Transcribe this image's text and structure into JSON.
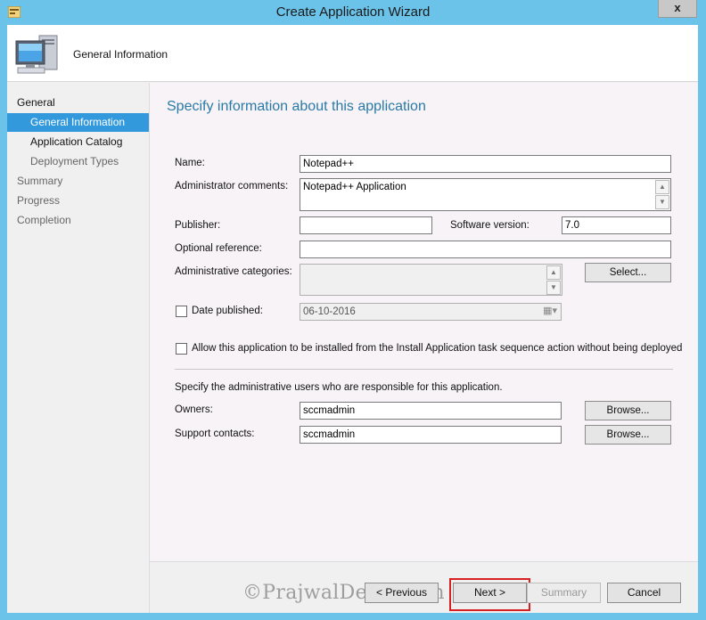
{
  "window": {
    "title": "Create Application Wizard",
    "close_glyph": "x"
  },
  "header": {
    "title": "General Information",
    "icon": "computer-icon"
  },
  "sidebar": {
    "items": [
      {
        "label": "General",
        "level": 1,
        "state": "dark"
      },
      {
        "label": "General Information",
        "level": 2,
        "state": "selected"
      },
      {
        "label": "Application Catalog",
        "level": 2,
        "state": "dark"
      },
      {
        "label": "Deployment Types",
        "level": 2,
        "state": "normal"
      },
      {
        "label": "Summary",
        "level": 1,
        "state": "normal"
      },
      {
        "label": "Progress",
        "level": 1,
        "state": "normal"
      },
      {
        "label": "Completion",
        "level": 1,
        "state": "normal"
      }
    ]
  },
  "page": {
    "title": "Specify information about this application",
    "name": {
      "label": "Name:",
      "value": "Notepad++"
    },
    "admin_comments": {
      "label": "Administrator comments:",
      "value": "Notepad++ Application"
    },
    "publisher": {
      "label": "Publisher:",
      "value": ""
    },
    "software_version": {
      "label": "Software version:",
      "value": "7.0"
    },
    "optional_reference": {
      "label": "Optional reference:",
      "value": ""
    },
    "admin_categories": {
      "label": "Administrative categories:",
      "value": "",
      "button": "Select..."
    },
    "date_published": {
      "label": "Date published:",
      "value": "06-10-2016",
      "checked": false
    },
    "allow_install": {
      "label": "Allow this application to be installed from the Install Application task sequence action without being deployed",
      "checked": false
    },
    "admin_users_text": "Specify the administrative users who are responsible for this application.",
    "owners": {
      "label": "Owners:",
      "value": "sccmadmin",
      "button": "Browse..."
    },
    "support_contacts": {
      "label": "Support contacts:",
      "value": "sccmadmin",
      "button": "Browse..."
    }
  },
  "footer": {
    "previous": "< Previous",
    "next": "Next >",
    "summary": "Summary",
    "cancel": "Cancel",
    "watermark": "©PrajwalDesai.com"
  },
  "colors": {
    "accent": "#3399dd",
    "title_blue": "#2a7aa6",
    "highlight": "#d82020",
    "chrome": "#6cc3ea"
  }
}
